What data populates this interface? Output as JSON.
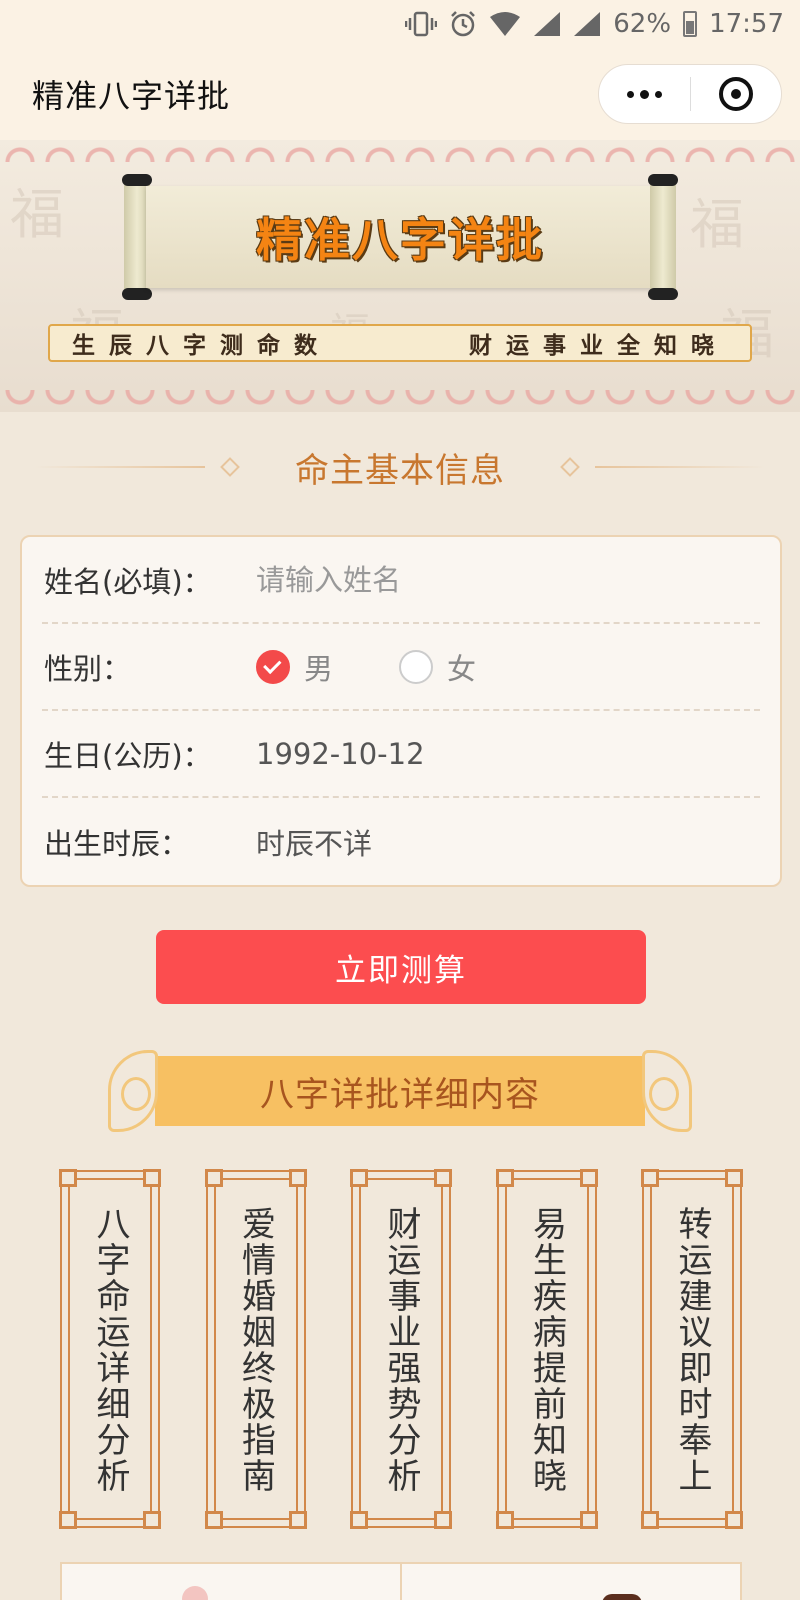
{
  "status_bar": {
    "battery": "62%",
    "time": "17:57"
  },
  "title_bar": {
    "title": "精准八字详批"
  },
  "banner": {
    "headline": "精准八字详批",
    "slogan_left": "生辰八字测命数",
    "slogan_right": "财运事业全知晓",
    "background_glyph": "福"
  },
  "form": {
    "section_title": "命主基本信息",
    "name_label": "姓名(必填)：",
    "name_placeholder": "请输入姓名",
    "gender_label": "性别：",
    "gender_options": [
      {
        "label": "男",
        "checked": true
      },
      {
        "label": "女",
        "checked": false
      }
    ],
    "birthday_label": "生日(公历)：",
    "birthday_value": "1992-10-12",
    "hour_label": "出生时辰：",
    "hour_value": "时辰不详",
    "submit_label": "立即测算"
  },
  "details": {
    "header": "八字详批详细内容",
    "features": [
      "八字命运详细分析",
      "爱情婚姻终极指南",
      "财运事业强势分析",
      "易生疾病提前知晓",
      "转运建议即时奉上"
    ]
  },
  "colors": {
    "accent_red": "#fc4d4f",
    "headline_orange": "#f48413",
    "section_brown": "#c8772f",
    "ribbon_yellow": "#f7c062",
    "page_bg": "#f1e8db"
  }
}
